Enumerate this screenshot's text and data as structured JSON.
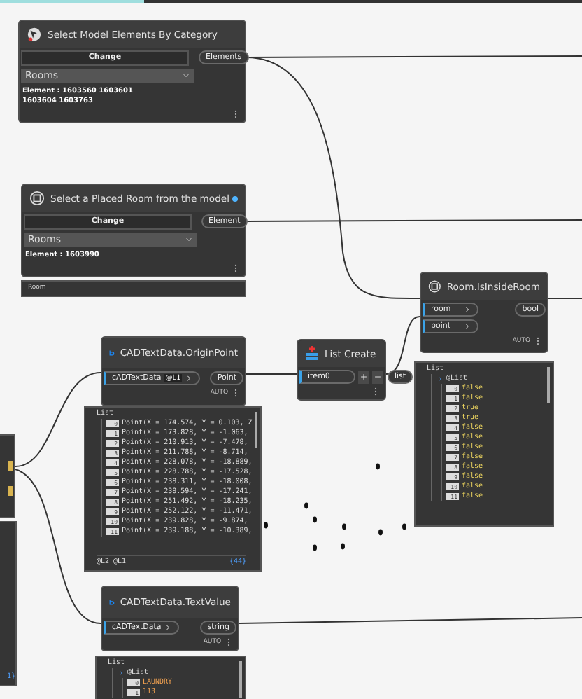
{
  "nodes": [
    {
      "kind": "select",
      "title": "Select Model Elements By Category",
      "button": "Change",
      "dropdown": "Rooms",
      "info": "Element : 1603560 1603601 1603604 1603763",
      "outputs": [
        "Elements"
      ],
      "info_dot": false
    },
    {
      "kind": "select",
      "title": "Select a Placed Room from the model",
      "button": "Change",
      "dropdown": "Rooms",
      "info": "Element : 1603990",
      "outputs": [
        "Element"
      ],
      "info_dot": true,
      "preview": {
        "kind": "bar",
        "text": "Room"
      }
    },
    {
      "kind": "function",
      "title": "CADTextData.OriginPoint",
      "inputs": [
        {
          "name": "cADTextData",
          "lacing": "@L1"
        }
      ],
      "outputs": [
        "Point"
      ],
      "lacing": "AUTO",
      "preview": {
        "kind": "list",
        "header": "List",
        "items": [
          {
            "index": "0",
            "value": "Point(X = 174.574, Y = 0.103, Z",
            "kind": "point"
          },
          {
            "index": "1",
            "value": "Point(X = 173.828, Y = -1.063,",
            "kind": "point"
          },
          {
            "index": "2",
            "value": "Point(X = 210.913, Y = -7.478,",
            "kind": "point"
          },
          {
            "index": "3",
            "value": "Point(X = 211.788, Y = -8.714,",
            "kind": "point"
          },
          {
            "index": "4",
            "value": "Point(X = 228.078, Y = -18.889,",
            "kind": "point"
          },
          {
            "index": "5",
            "value": "Point(X = 228.788, Y = -17.528,",
            "kind": "point"
          },
          {
            "index": "6",
            "value": "Point(X = 238.311, Y = -18.008,",
            "kind": "point"
          },
          {
            "index": "7",
            "value": "Point(X = 238.594, Y = -17.241,",
            "kind": "point"
          },
          {
            "index": "8",
            "value": "Point(X = 251.492, Y = -18.235,",
            "kind": "point"
          },
          {
            "index": "9",
            "value": "Point(X = 252.122, Y = -11.471,",
            "kind": "point"
          },
          {
            "index": "10",
            "value": "Point(X = 239.828, Y = -9.874,",
            "kind": "point"
          },
          {
            "index": "11",
            "value": "Point(X = 239.188, Y = -10.389,",
            "kind": "point"
          }
        ],
        "levels": "@L2 @L1",
        "count": "{44}"
      }
    },
    {
      "kind": "list_create",
      "title": "List Create",
      "inputs": [
        {
          "name": "item0"
        }
      ],
      "outputs": [
        "list"
      ]
    },
    {
      "kind": "function",
      "title": "Room.IsInsideRoom",
      "inputs": [
        {
          "name": "room"
        },
        {
          "name": "point"
        }
      ],
      "outputs": [
        "bool"
      ],
      "lacing": "AUTO",
      "preview": {
        "kind": "list",
        "header": "List",
        "sublist": "@List",
        "items": [
          {
            "index": "0",
            "value": "false",
            "kind": "bool"
          },
          {
            "index": "1",
            "value": "false",
            "kind": "bool"
          },
          {
            "index": "2",
            "value": "true",
            "kind": "bool"
          },
          {
            "index": "3",
            "value": "true",
            "kind": "bool"
          },
          {
            "index": "4",
            "value": "false",
            "kind": "bool"
          },
          {
            "index": "5",
            "value": "false",
            "kind": "bool"
          },
          {
            "index": "6",
            "value": "false",
            "kind": "bool"
          },
          {
            "index": "7",
            "value": "false",
            "kind": "bool"
          },
          {
            "index": "8",
            "value": "false",
            "kind": "bool"
          },
          {
            "index": "9",
            "value": "false",
            "kind": "bool"
          },
          {
            "index": "10",
            "value": "false",
            "kind": "bool"
          },
          {
            "index": "11",
            "value": "false",
            "kind": "bool"
          }
        ]
      }
    },
    {
      "kind": "function",
      "title": "CADTextData.TextValue",
      "inputs": [
        {
          "name": "cADTextData"
        }
      ],
      "outputs": [
        "string"
      ],
      "lacing": "AUTO",
      "preview": {
        "kind": "list",
        "header": "List",
        "sublist": "@List",
        "items": [
          {
            "index": "0",
            "value": "LAUNDRY",
            "kind": "string"
          },
          {
            "index": "1",
            "value": "113",
            "kind": "string"
          }
        ]
      }
    }
  ],
  "partial_preview": {
    "footer": "1}"
  }
}
